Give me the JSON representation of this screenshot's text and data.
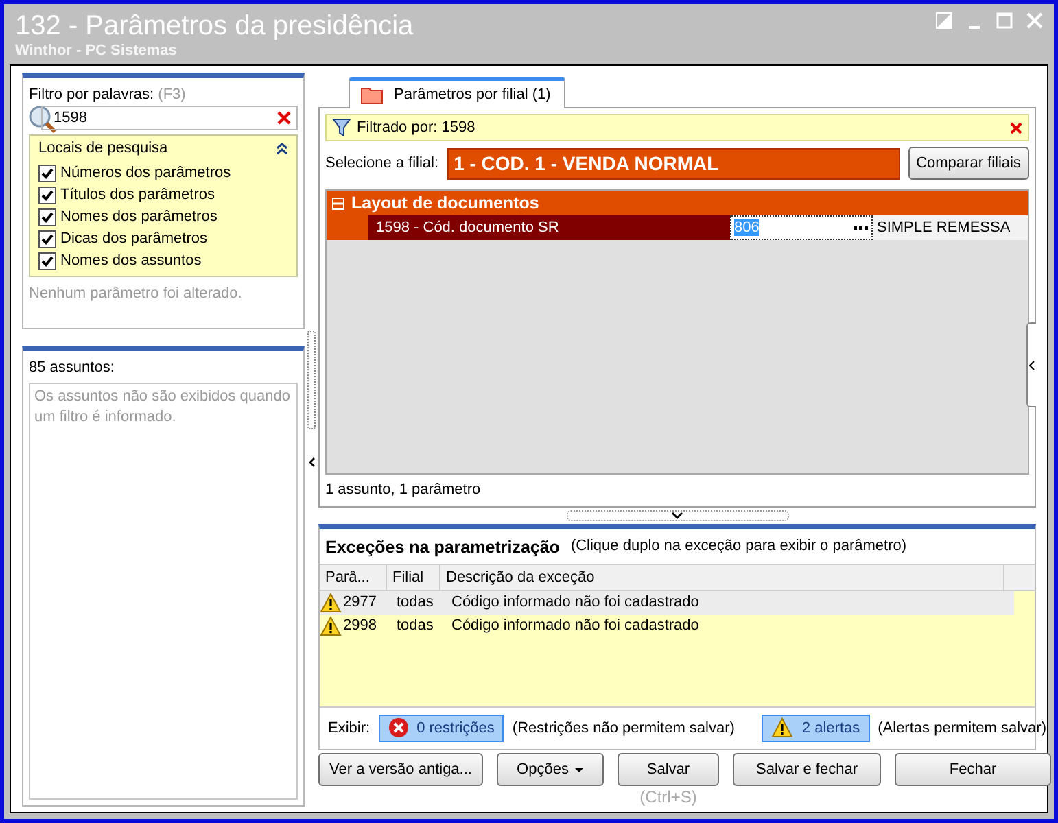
{
  "window": {
    "title": "132 - Parâmetros da presidência",
    "subtitle": "Winthor - PC Sistemas"
  },
  "search_panel": {
    "label": "Filtro por palavras:",
    "shortcut": "(F3)",
    "value": "1598",
    "locations": {
      "title": "Locais de pesquisa",
      "expanded": true,
      "options": [
        {
          "label": "Números dos parâmetros",
          "checked": true
        },
        {
          "label": "Títulos dos parâmetros",
          "checked": true
        },
        {
          "label": "Nomes dos parâmetros",
          "checked": true
        },
        {
          "label": "Dicas dos parâmetros",
          "checked": true
        },
        {
          "label": "Nomes dos assuntos",
          "checked": true
        }
      ]
    },
    "status": "Nenhum parâmetro foi alterado."
  },
  "subjects_panel": {
    "title": "85 assuntos:",
    "message": "Os assuntos não são exibidos quando um filtro é informado."
  },
  "tabs": [
    {
      "label": "Parâmetros por filial  (1)",
      "selected": true
    }
  ],
  "filter_bar": {
    "text": "Filtrado por: 1598"
  },
  "branch": {
    "label": "Selecione a filial:",
    "value": "1 - COD. 1 - VENDA NORMAL",
    "compare_button": "Comparar filiais"
  },
  "parameter_grid": {
    "groups": [
      {
        "title": "Layout de documentos",
        "expanded": true,
        "rows": [
          {
            "name": "1598 - Cód. documento SR",
            "value": "806",
            "description": "SIMPLE REMESSA",
            "selected": true
          }
        ]
      }
    ]
  },
  "summary": "1 assunto, 1 parâmetro",
  "exceptions": {
    "title": "Exceções na parametrização",
    "hint": "(Clique duplo na exceção para exibir o parâmetro)",
    "columns": [
      "Parâ...",
      "Filial",
      "Descrição da exceção"
    ],
    "rows": [
      {
        "parameter": "2977",
        "branch": "todas",
        "description": "Código informado não foi cadastrado",
        "selected": true
      },
      {
        "parameter": "2998",
        "branch": "todas",
        "description": "Código informado não foi cadastrado",
        "selected": false
      }
    ],
    "filter_label": "Exibir:",
    "filters": [
      {
        "kind": "error",
        "label": "0 restrições",
        "note": "(Restrições não permitem salvar)",
        "on": true
      },
      {
        "kind": "warning",
        "label": "2 alertas",
        "note": "(Alertas permitem salvar)",
        "on": true
      }
    ]
  },
  "buttons": [
    {
      "label": "Ver a versão antiga...",
      "kind": "button"
    },
    {
      "label": "Opções",
      "kind": "dropdown"
    },
    {
      "label": "Salvar",
      "kind": "button",
      "hint": "(Ctrl+S)"
    },
    {
      "label": "Salvar e fechar",
      "kind": "button"
    },
    {
      "label": "Fechar",
      "kind": "button"
    }
  ]
}
